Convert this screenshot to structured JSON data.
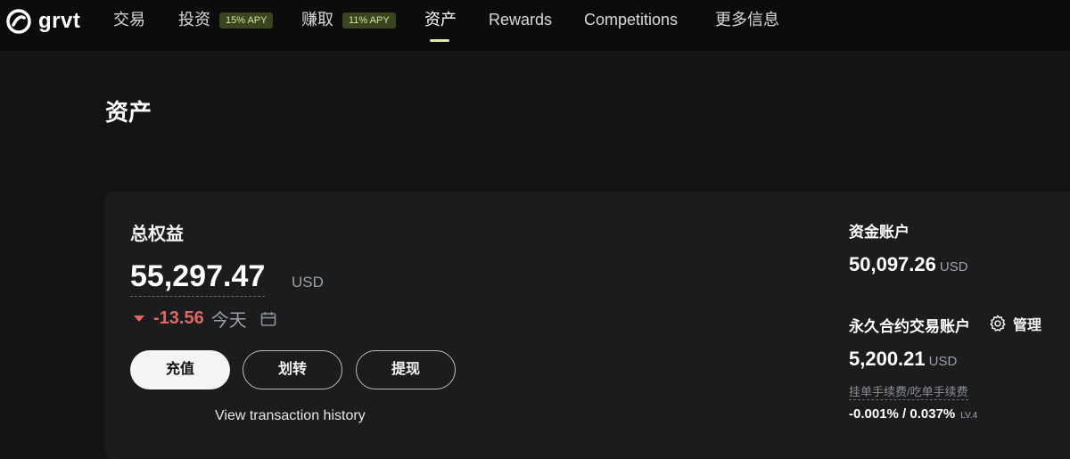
{
  "brand": {
    "name": "grvt"
  },
  "nav": {
    "items": [
      {
        "label": "交易"
      },
      {
        "label": "投资",
        "badge": "15% APY"
      },
      {
        "label": "赚取",
        "badge": "11% APY"
      },
      {
        "label": "资产",
        "active": true
      },
      {
        "label": "Rewards"
      },
      {
        "label": "Competitions"
      },
      {
        "label": "更多信息"
      }
    ]
  },
  "page": {
    "title": "资产"
  },
  "equity": {
    "label": "总权益",
    "value": "55,297.47",
    "unit": "USD",
    "change": "-13.56",
    "period": "今天",
    "direction": "down"
  },
  "actions": {
    "deposit": "充值",
    "transfer": "划转",
    "withdraw": "提现",
    "history": "View transaction history"
  },
  "accounts": {
    "funding": {
      "label": "资金账户",
      "value": "50,097.26",
      "unit": "USD"
    },
    "perpetual": {
      "label": "永久合约交易账户",
      "manage": "管理",
      "value": "5,200.21",
      "unit": "USD"
    }
  },
  "fees": {
    "label": "挂单手续费/吃单手续费",
    "value": "-0.001% / 0.037%",
    "level": "LV.4"
  },
  "colors": {
    "background": "#131415",
    "card": "#1b1c1e",
    "negative": "#e2675f",
    "badge_bg": "#3a4420",
    "badge_text": "#d6e59a",
    "active_underline": "#e2e8a8"
  },
  "icons": [
    "grvt-logo-icon",
    "down-arrow-icon",
    "calendar-icon",
    "gear-icon"
  ]
}
